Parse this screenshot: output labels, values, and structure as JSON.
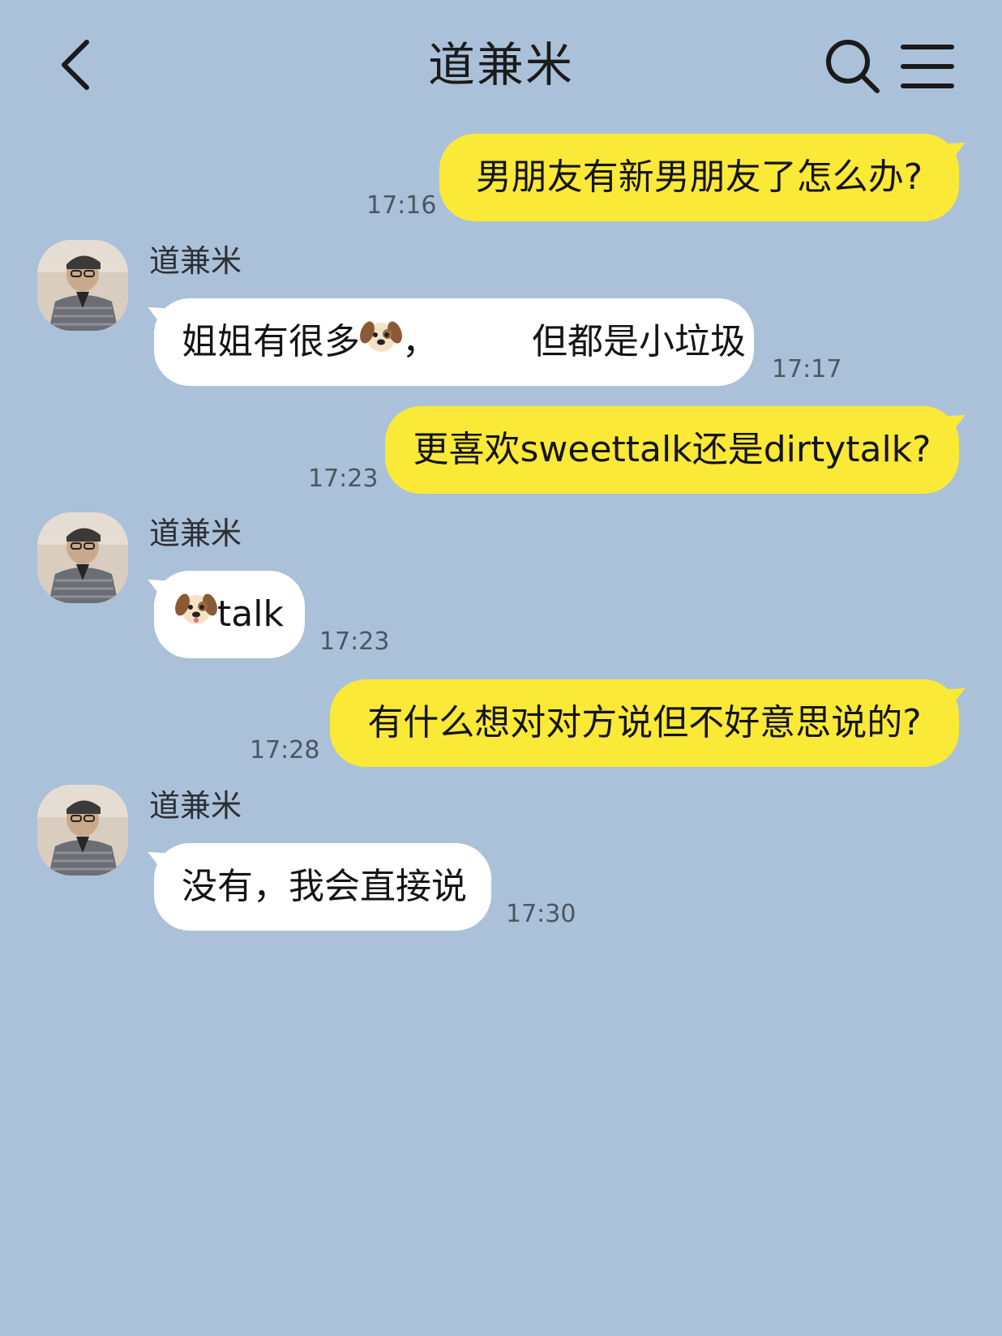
{
  "header": {
    "title": "道兼米"
  },
  "messages": [
    {
      "from": "me",
      "text": "男朋友有新男朋友了怎么办?",
      "time": "17:16"
    },
    {
      "from": "them",
      "sender": "道兼米",
      "text_before": "姐姐有很多",
      "emoji": "dog-face",
      "text_mid": "，",
      "text_after": "但都是小垃圾",
      "time": "17:17"
    },
    {
      "from": "me",
      "text": "更喜欢sweettalk还是dirtytalk?",
      "time": "17:23"
    },
    {
      "from": "them",
      "sender": "道兼米",
      "emoji": "dog-face",
      "text_after": "talk",
      "time": "17:23"
    },
    {
      "from": "me",
      "text": "有什么想对对方说但不好意思说的?",
      "time": "17:28"
    },
    {
      "from": "them",
      "sender": "道兼米",
      "text": "没有，我会直接说",
      "time": "17:30"
    }
  ],
  "colors": {
    "background": "#abc1d9",
    "my_bubble": "#fbe937",
    "their_bubble": "#ffffff"
  },
  "icons": {
    "back": "chevron-left-icon",
    "search": "search-icon",
    "menu": "menu-icon"
  }
}
